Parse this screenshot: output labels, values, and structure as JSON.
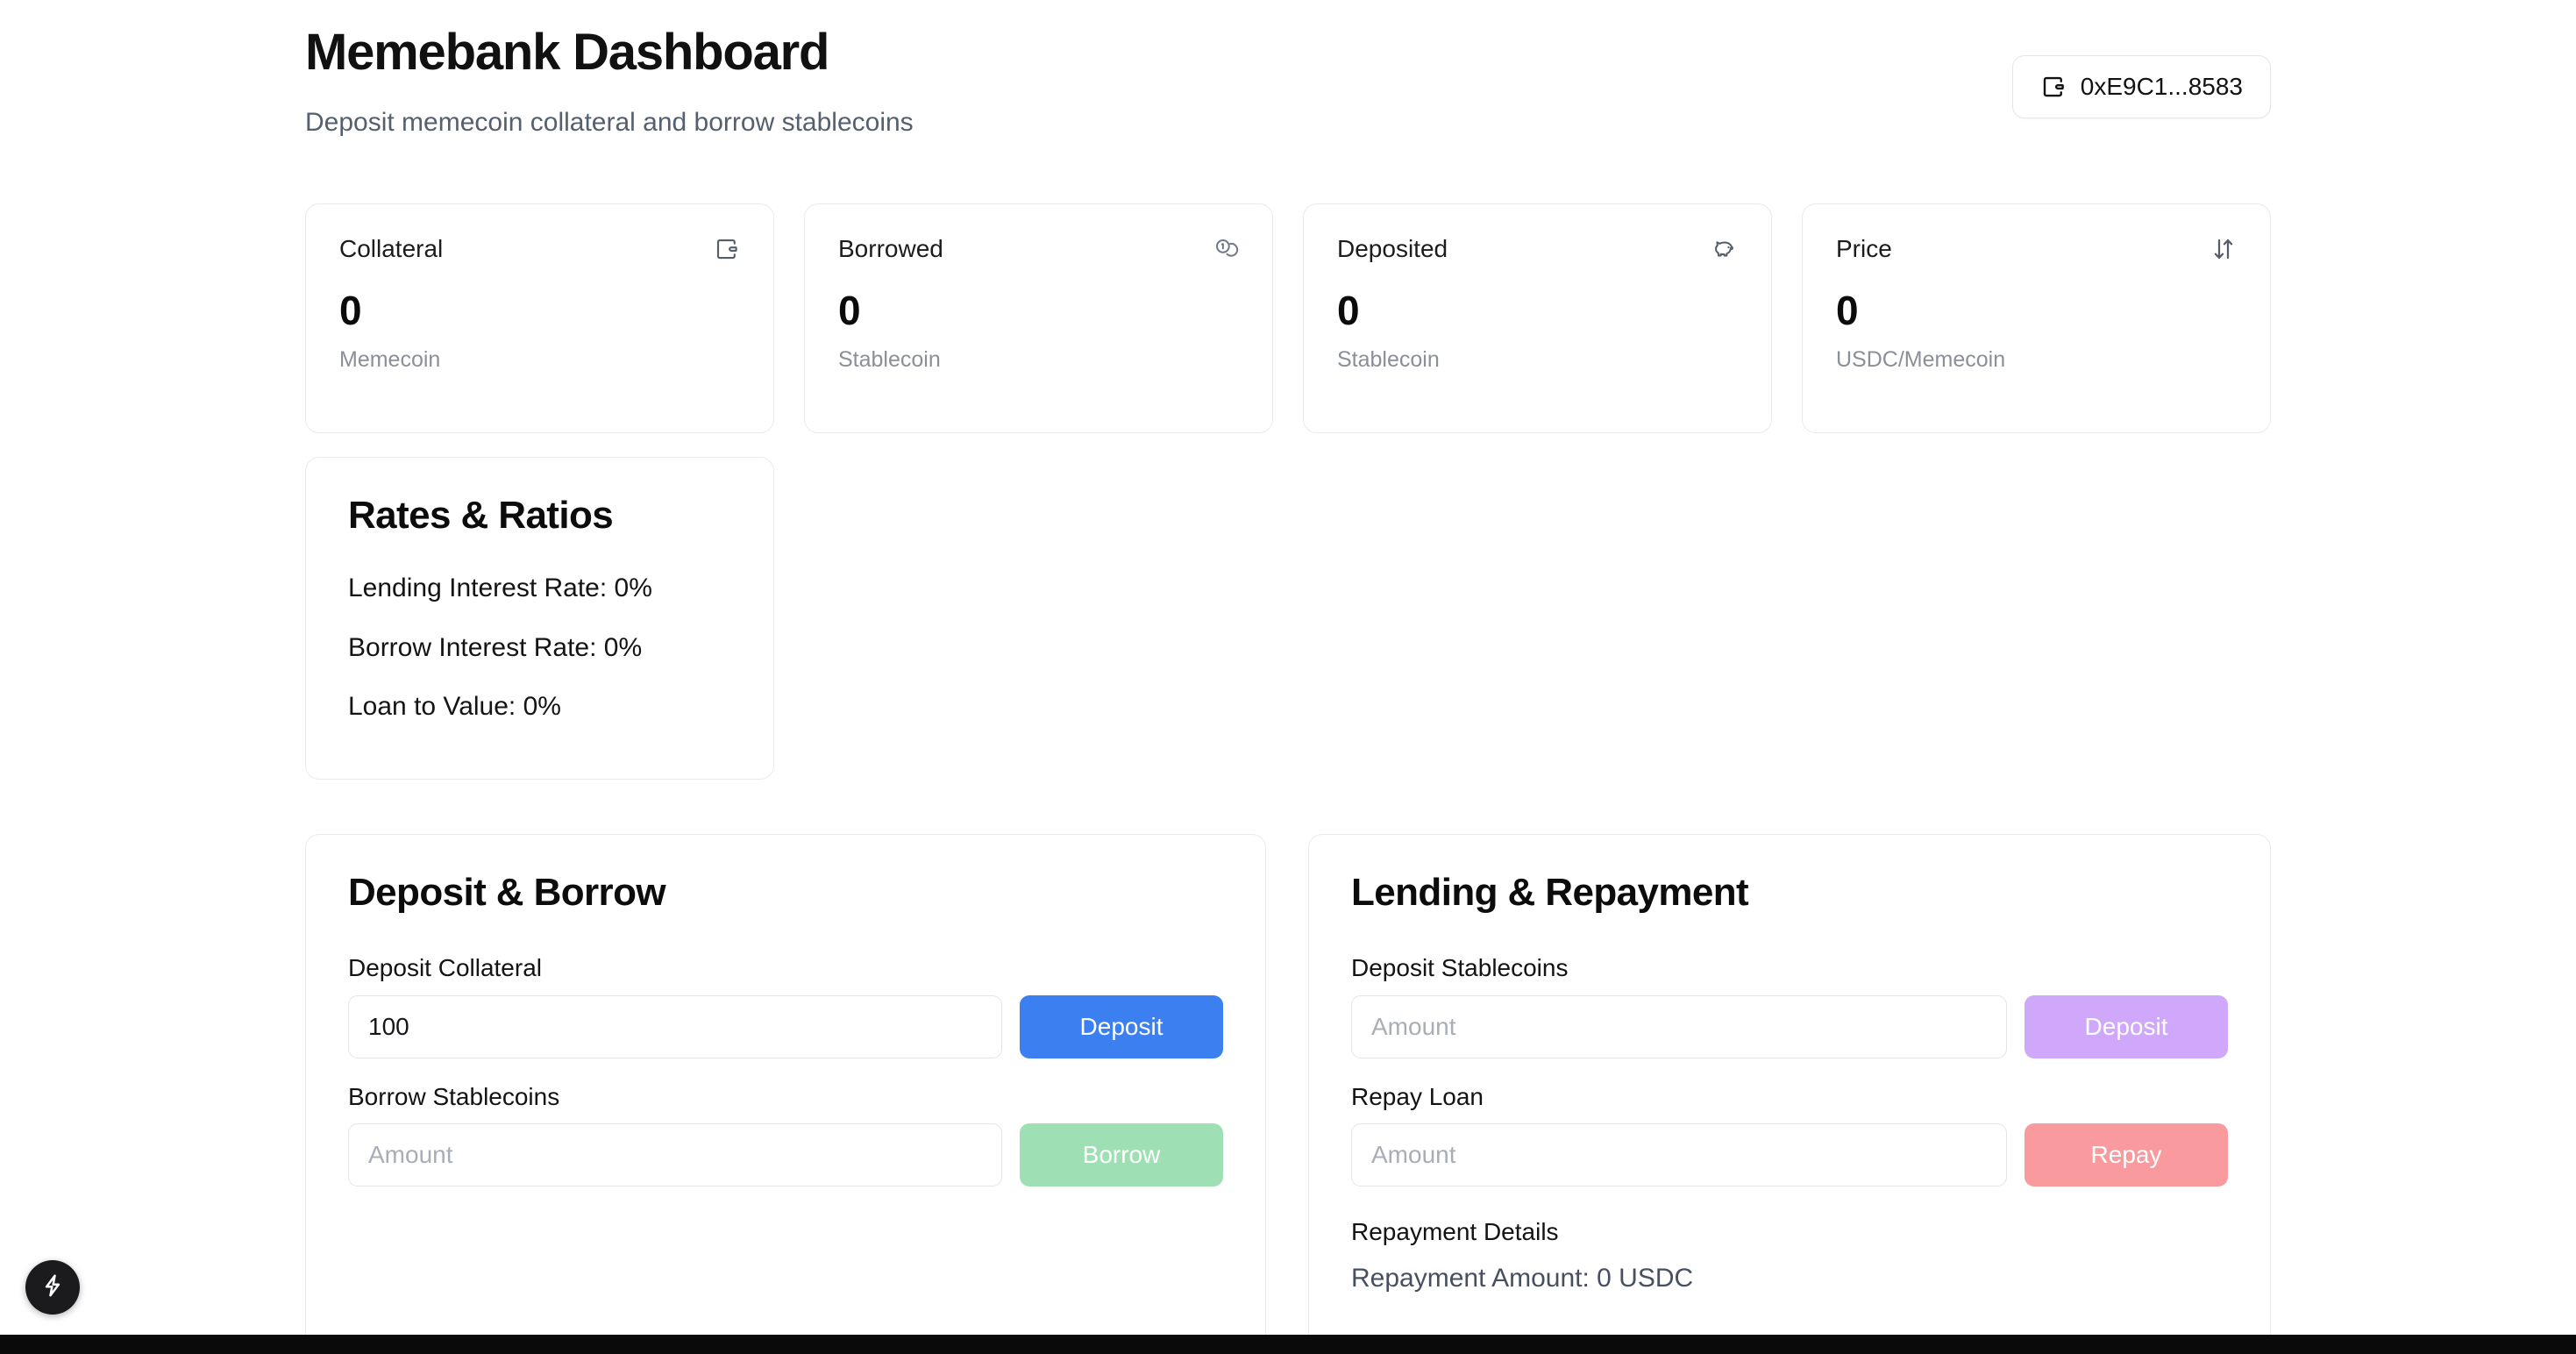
{
  "header": {
    "title": "Memebank Dashboard",
    "subtitle": "Deposit memecoin collateral and borrow stablecoins",
    "wallet": {
      "icon": "wallet-icon",
      "address": "0xE9C1...8583"
    }
  },
  "stats": [
    {
      "label": "Collateral",
      "value": "0",
      "unit": "Memecoin",
      "icon": "wallet-icon"
    },
    {
      "label": "Borrowed",
      "value": "0",
      "unit": "Stablecoin",
      "icon": "coins-icon"
    },
    {
      "label": "Deposited",
      "value": "0",
      "unit": "Stablecoin",
      "icon": "piggy-bank-icon"
    },
    {
      "label": "Price",
      "value": "0",
      "unit": "USDC/Memecoin",
      "icon": "arrows-up-down-icon"
    }
  ],
  "rates": {
    "title": "Rates & Ratios",
    "items": [
      "Lending Interest Rate: 0%",
      "Borrow Interest Rate: 0%",
      "Loan to Value: 0%"
    ]
  },
  "deposit_borrow": {
    "title": "Deposit & Borrow",
    "collateral": {
      "label": "Deposit Collateral",
      "value": "100",
      "placeholder": "Amount",
      "button": "Deposit"
    },
    "borrow": {
      "label": "Borrow Stablecoins",
      "value": "",
      "placeholder": "Amount",
      "button": "Borrow"
    }
  },
  "lending_repayment": {
    "title": "Lending & Repayment",
    "deposit": {
      "label": "Deposit Stablecoins",
      "value": "",
      "placeholder": "Amount",
      "button": "Deposit"
    },
    "repay": {
      "label": "Repay Loan",
      "value": "",
      "placeholder": "Amount",
      "button": "Repay"
    },
    "details": {
      "title": "Repayment Details",
      "amount_line": "Repayment Amount: 0 USDC"
    }
  },
  "fab": {
    "icon": "lightning-bolt-icon"
  },
  "colors": {
    "deposit_collateral_button": "#3b7ff0",
    "borrow_button": "#9ee0b4",
    "deposit_stablecoin_button": "#cfa7fb",
    "repay_button": "#f99a9e",
    "card_border": "#e8eaed",
    "muted_text": "#8a8f98"
  }
}
